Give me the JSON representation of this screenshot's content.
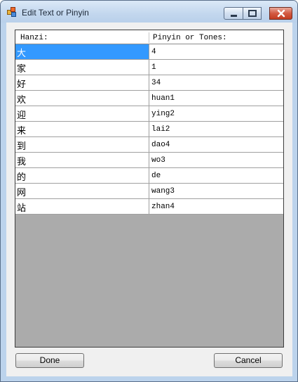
{
  "window": {
    "title": "Edit Text or Pinyin",
    "icon": "app-icon"
  },
  "grid": {
    "columns": {
      "hanzi": "Hanzi:",
      "pinyin": "Pinyin or Tones:"
    },
    "selected_row": 0,
    "rows": [
      {
        "hanzi": "大",
        "pinyin": "4"
      },
      {
        "hanzi": "家",
        "pinyin": "1"
      },
      {
        "hanzi": "好",
        "pinyin": "34"
      },
      {
        "hanzi": "欢",
        "pinyin": "huan1"
      },
      {
        "hanzi": "迎",
        "pinyin": "ying2"
      },
      {
        "hanzi": "来",
        "pinyin": "lai2"
      },
      {
        "hanzi": "到",
        "pinyin": "dao4"
      },
      {
        "hanzi": "我",
        "pinyin": "wo3"
      },
      {
        "hanzi": "的",
        "pinyin": "de"
      },
      {
        "hanzi": "网",
        "pinyin": "wang3"
      },
      {
        "hanzi": "站",
        "pinyin": "zhan4"
      }
    ]
  },
  "buttons": {
    "done": "Done",
    "cancel": "Cancel"
  },
  "colors": {
    "selection": "#3399ff",
    "grid_background": "#ababab"
  }
}
